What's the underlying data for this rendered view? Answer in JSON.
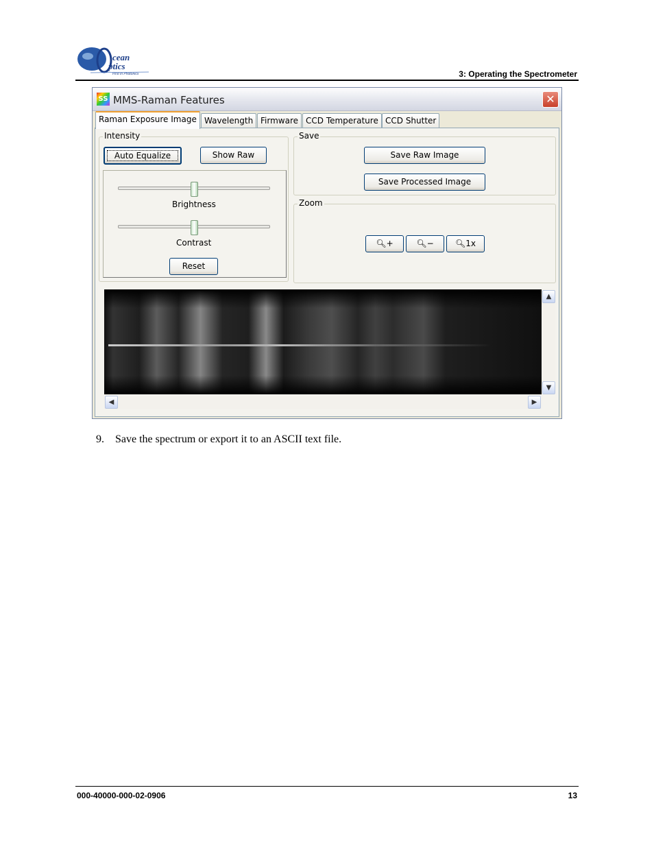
{
  "header": {
    "logo_text": "Ocean Optics Inc. First in Photonics",
    "section": "3: Operating the Spectrometer"
  },
  "window": {
    "title": "MMS-Raman Features",
    "app_icon": "ss-app-icon",
    "tabs": [
      {
        "label": "Raman Exposure Image",
        "active": true
      },
      {
        "label": "Wavelength"
      },
      {
        "label": "Firmware"
      },
      {
        "label": "CCD Temperature"
      },
      {
        "label": "CCD Shutter"
      }
    ],
    "intensity": {
      "label": "Intensity",
      "auto_equalize": "Auto Equalize",
      "show_raw": "Show Raw",
      "brightness_label": "Brightness",
      "contrast_label": "Contrast",
      "reset": "Reset",
      "brightness_level": 0.5,
      "contrast_level": 0.5
    },
    "save": {
      "label": "Save",
      "save_raw": "Save Raw Image",
      "save_processed": "Save Processed Image"
    },
    "zoom": {
      "label": "Zoom",
      "icons": [
        "zoom-in-icon",
        "zoom-out-icon",
        "zoom-1x-icon"
      ]
    }
  },
  "body": {
    "step_number": "9.",
    "step_text": "Save the spectrum or export it to an ASCII text file."
  },
  "footer": {
    "doc_number": "000-40000-000-02-0906",
    "page_number": "13"
  }
}
